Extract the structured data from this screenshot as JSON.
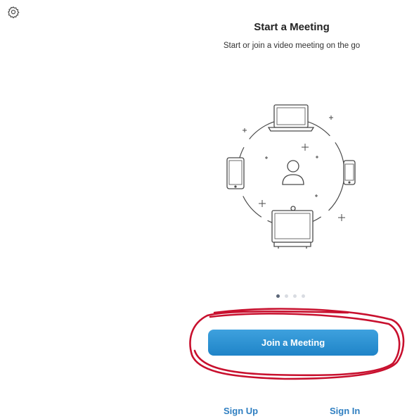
{
  "header": {
    "settings_icon": "gear-icon"
  },
  "intro": {
    "title": "Start a Meeting",
    "subtitle": "Start or join a video meeting on the go"
  },
  "illustration": {
    "devices": [
      "laptop-icon",
      "tablet-icon",
      "phone-icon",
      "conference-camera-icon",
      "person-icon"
    ]
  },
  "pager": {
    "count": 4,
    "active_index": 0
  },
  "actions": {
    "join_label": "Join a Meeting",
    "sign_up_label": "Sign Up",
    "sign_in_label": "Sign In"
  },
  "colors": {
    "primary_button": "#2d8cff",
    "link": "#2f7fc1",
    "annotation_circle": "#c8102e"
  }
}
